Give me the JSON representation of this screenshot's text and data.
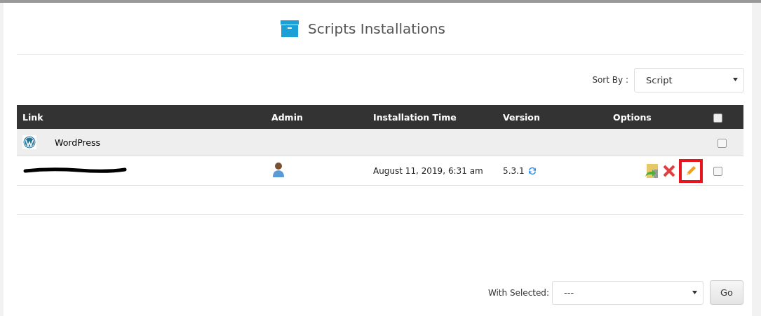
{
  "title": "Scripts Installations",
  "sort": {
    "label": "Sort By :",
    "value": "Script"
  },
  "table": {
    "columns": [
      "Link",
      "Admin",
      "Installation Time",
      "Version",
      "Options"
    ],
    "select_all_checked": false,
    "group": {
      "name": "WordPress",
      "checked": false
    },
    "rows": [
      {
        "time": "August 11, 2019, 6:31 am",
        "version": "5.3.1",
        "checked": false,
        "edit_highlighted": true
      }
    ]
  },
  "bulk": {
    "label": "With Selected:",
    "value": "---",
    "button": "Go"
  }
}
